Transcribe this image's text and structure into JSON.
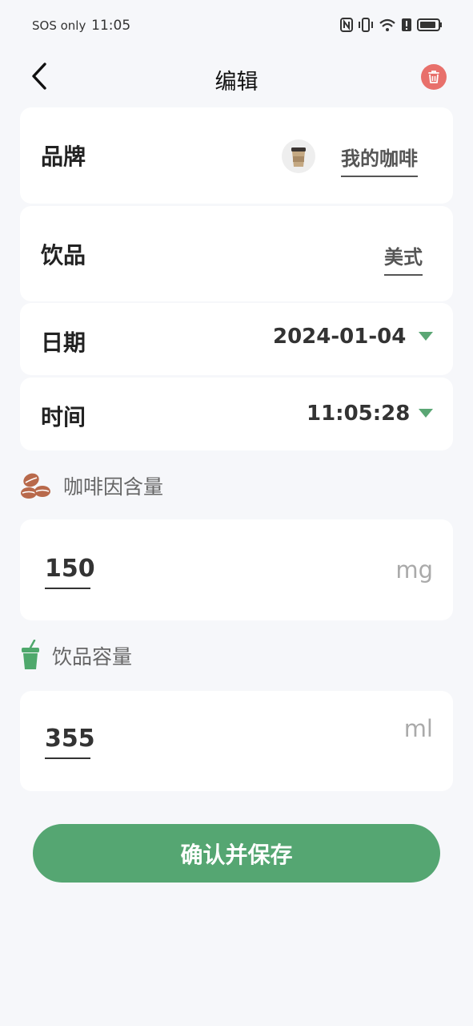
{
  "status_bar": {
    "carrier": "SOS only",
    "time": "11:05"
  },
  "header": {
    "title": "编辑",
    "back_icon": "chevron-left-icon",
    "delete_icon": "trash-icon"
  },
  "brand": {
    "label": "品牌",
    "value": "我的咖啡",
    "avatar_icon": "coffee-cup-icon"
  },
  "drink": {
    "label": "饮品",
    "value": "美式"
  },
  "date": {
    "label": "日期",
    "value": "2024-01-04"
  },
  "time": {
    "label": "时间",
    "value": "11:05:28"
  },
  "caffeine": {
    "section_label": "咖啡因含量",
    "icon": "coffee-beans-icon",
    "value": "150",
    "unit": "mg"
  },
  "volume": {
    "section_label": "饮品容量",
    "icon": "cup-icon",
    "value": "355",
    "unit": "ml"
  },
  "save_button": {
    "label": "确认并保存"
  },
  "colors": {
    "accent": "#55a672",
    "delete": "#e8706b",
    "background": "#f6f7fa",
    "card": "#ffffff"
  }
}
